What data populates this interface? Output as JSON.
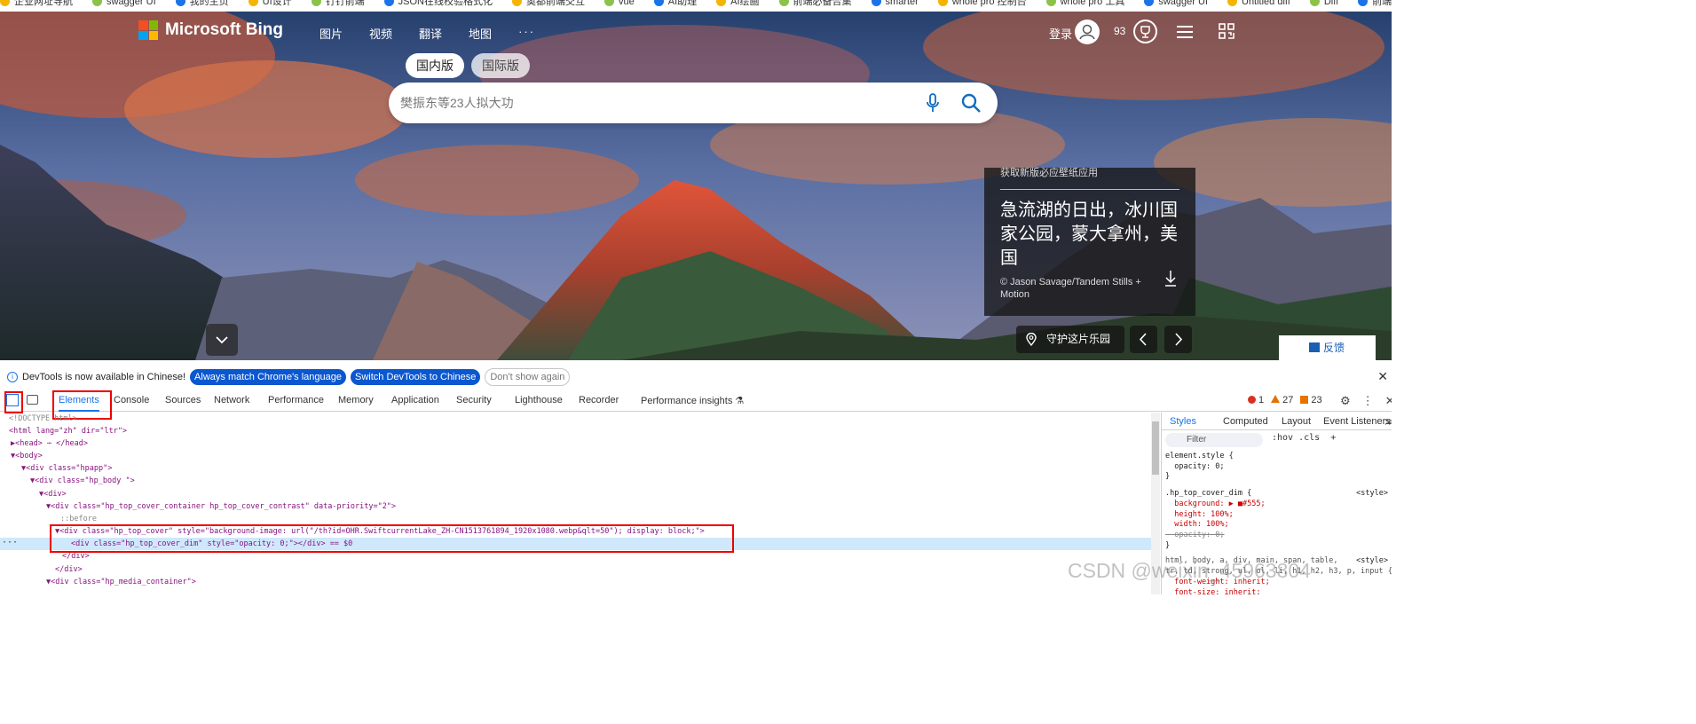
{
  "bookmarks": [
    "企业网址导航",
    "swagger UI",
    "我的主页",
    "UI设计",
    "钉钉前端",
    "JSON在线校验格式化",
    "奥都前端交互",
    "vue",
    "AI助理",
    "AI绘画",
    "前端必备合集",
    "smarter",
    "whole pro 控制台",
    "whole pro 工具",
    "swagger UI",
    "Untitled diff",
    "Diff",
    "前端组件合集"
  ],
  "bing": {
    "logo_text": "Microsoft Bing",
    "nav": [
      "图片",
      "视频",
      "翻译",
      "地图"
    ],
    "nav_more": "···",
    "login": "登录",
    "points": "93",
    "region_tabs": [
      "国内版",
      "国际版"
    ],
    "search_placeholder": "樊振东等23人拟大功",
    "card": {
      "promo": "获取新版必应壁纸应用",
      "title": "急流湖的日出，冰川国家公园，蒙大拿州，美国",
      "credit": "© Jason Savage/Tandem Stills + Motion"
    },
    "guard_label": "守护这片乐园",
    "feedback": "反馈"
  },
  "notice": {
    "text": "DevTools is now available in Chinese!",
    "btn_match": "Always match Chrome's language",
    "btn_switch": "Switch DevTools to Chinese",
    "btn_dismiss": "Don't show again"
  },
  "devtools": {
    "tabs": [
      "Elements",
      "Console",
      "Sources",
      "Network",
      "Performance",
      "Memory",
      "Application",
      "Security",
      "Lighthouse",
      "Recorder",
      "Performance insights ⚗"
    ],
    "errors": "1",
    "warnings": "27",
    "issues": "23",
    "dom": [
      "<!DOCTYPE html>",
      "<html lang=\"zh\" dir=\"ltr\">",
      "▶<head> ⋯ </head>",
      "▼<body>",
      "▼<div class=\"hpapp\">",
      "▼<div class=\"hp_body  \">",
      "▼<div>",
      "▼<div class=\"hp_top_cover_container hp_top_cover_contrast\" data-priority=\"2\">",
      "::before",
      "▼<div class=\"hp_top_cover\" style=\"background-image: url(\"/th?id=OHR.SwiftcurrentLake_ZH-CN1513761894_1920x1080.webp&qlt=50\"); display: block;\">",
      "<div class=\"hp_top_cover_dim\" style=\"opacity: 0;\"></div> == $0",
      "</div>",
      "</div>",
      "▼<div class=\"hp_media_container\">"
    ],
    "dom_dots": "···",
    "styles_tabs": [
      "Styles",
      "Computed",
      "Layout",
      "Event Listeners",
      "≫"
    ],
    "filter_placeholder": "Filter",
    "filter_tools": ":hov .cls  +",
    "rule1": "element.style {\n  opacity: 0;\n}",
    "rule2_selector": ".hp_top_cover_dim {",
    "rule2_src": "<style>",
    "rule2_body": "  background: ▶ ■#555;\n  height: 100%;\n  width: 100%;",
    "rule2_struck": "  opacity: 0;",
    "rule2_end": "}",
    "rule3_selector": "html, body, a, div, main, span, table,\ntr, td, strong, ul, ol, li, h1, h2, h3, p, input {",
    "rule3_src": "<style>",
    "rule3_body": "  font-weight: inherit;\n  font-size: inherit;"
  },
  "watermark": "CSDN @weixin_45963804",
  "colors": {
    "devtools_accent": "#1a73e8",
    "highlight_box": "#ee0000",
    "bing_blue": "#0f6cbd"
  }
}
